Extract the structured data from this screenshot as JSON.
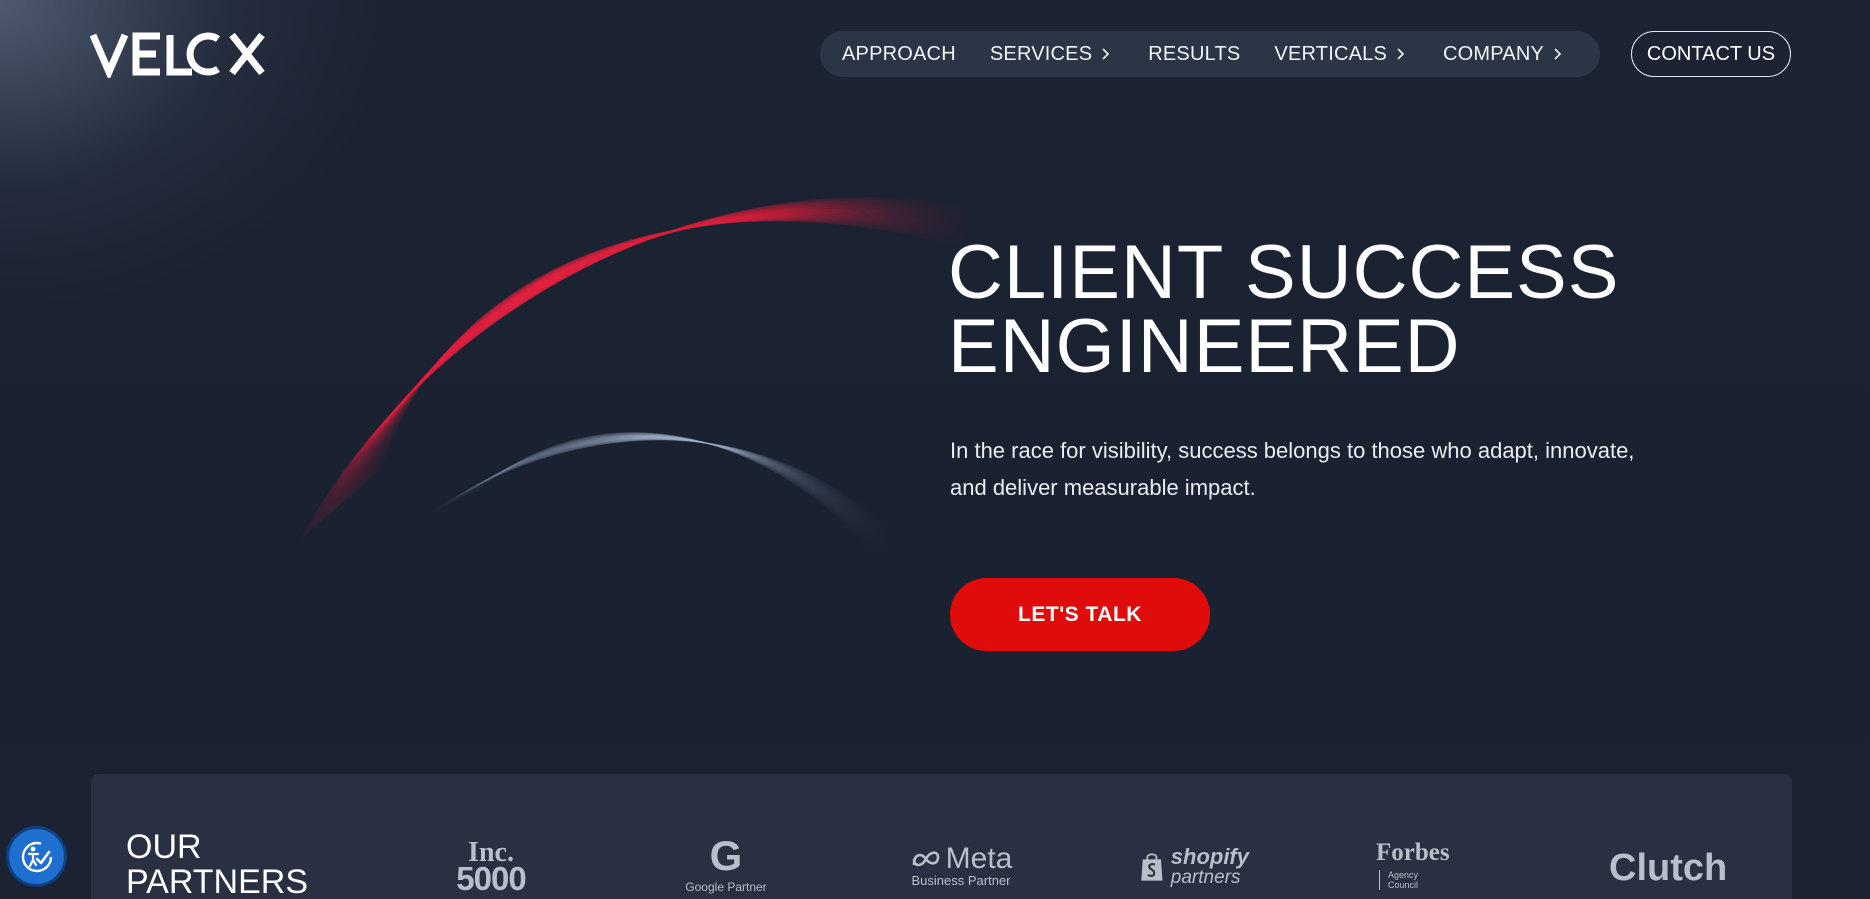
{
  "brand": {
    "logo_text": "VELOX",
    "accent_color": "#e00c0c",
    "background_color": "#1b2231"
  },
  "nav": {
    "items": [
      {
        "label": "APPROACH",
        "has_submenu": false
      },
      {
        "label": "SERVICES",
        "has_submenu": true
      },
      {
        "label": "RESULTS",
        "has_submenu": false
      },
      {
        "label": "VERTICALS",
        "has_submenu": true
      },
      {
        "label": "COMPANY",
        "has_submenu": true
      }
    ],
    "contact_label": "CONTACT US"
  },
  "hero": {
    "title_line1": "CLIENT SUCCESS",
    "title_line2": "ENGINEERED",
    "subtitle_line1": "In the race for visibility, success belongs to those who adapt, innovate,",
    "subtitle_line2": "and deliver measurable impact.",
    "cta_label": "LET'S TALK"
  },
  "partners": {
    "title_line1": "OUR",
    "title_line2": "PARTNERS",
    "logos": {
      "inc": {
        "line1": "Inc.",
        "line2": "5000"
      },
      "google": {
        "mark": "G",
        "caption": "Google Partner"
      },
      "meta": {
        "mark": "Meta",
        "caption": "Business Partner"
      },
      "shopify": {
        "line1": "shopify",
        "line2": "partners"
      },
      "forbes": {
        "name": "Forbes",
        "sub1": "Agency",
        "sub2": "Council"
      },
      "clutch": {
        "name": "Clutch"
      }
    }
  },
  "accessibility": {
    "icon": "accessibility-check-icon"
  }
}
